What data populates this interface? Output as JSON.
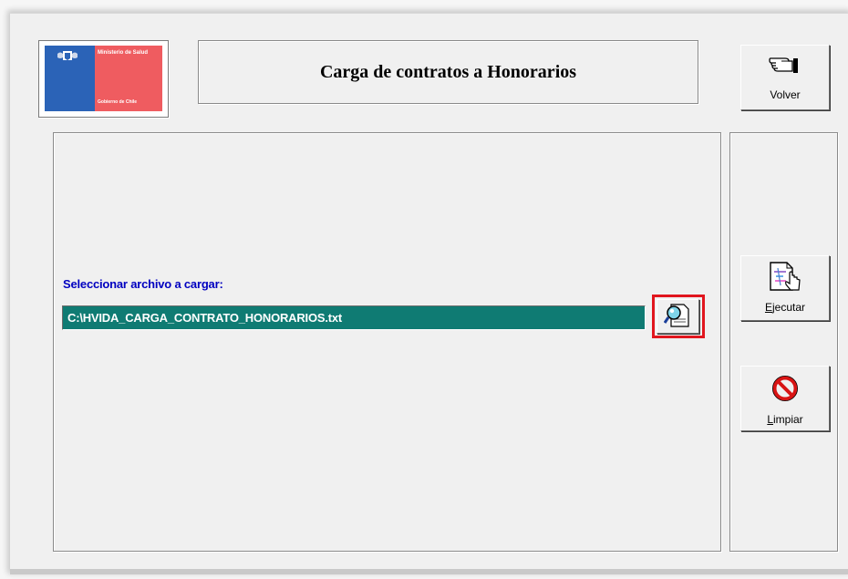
{
  "header": {
    "logo_text": "Ministerio de Salud",
    "logo_footer": "Gobierno de Chile",
    "title": "Carga de contratos a Honorarios"
  },
  "toolbar": {
    "volver_label": "Volver",
    "volver_icon": "pointing-hand-icon",
    "ejecutar_label": "Ejecutar",
    "ejecutar_mnemonic": "E",
    "ejecutar_rest": "jecutar",
    "ejecutar_icon": "document-pointer-icon",
    "limpiar_label": "Limpiar",
    "limpiar_mnemonic": "L",
    "limpiar_rest": "impiar",
    "limpiar_icon": "no-symbol-icon"
  },
  "form": {
    "select_label": "Seleccionar archivo a cargar:",
    "file_path": "C:\\HVIDA_CARGA_CONTRATO_HONORARIOS.txt",
    "browse_icon": "magnifier-document-icon"
  },
  "colors": {
    "field_bg": "#0f7b73",
    "label_color": "#0000c0",
    "highlight": "#e1161e"
  }
}
